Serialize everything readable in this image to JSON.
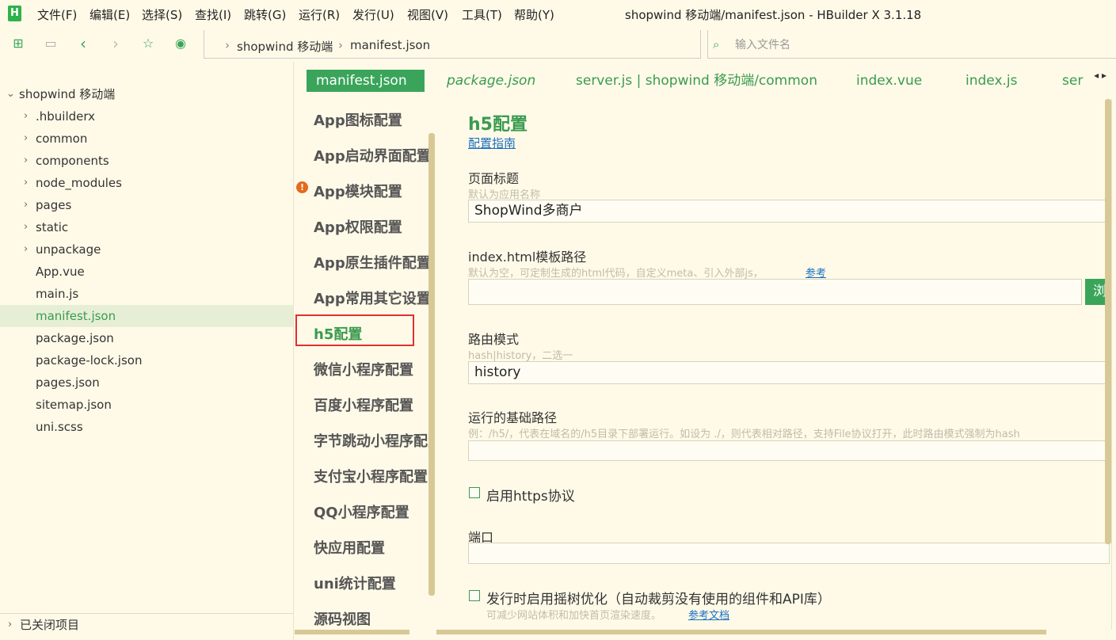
{
  "app": {
    "logo": "H",
    "window_title": "shopwind 移动端/manifest.json - HBuilder X 3.1.18"
  },
  "menu": [
    "文件(F)",
    "编辑(E)",
    "选择(S)",
    "查找(I)",
    "跳转(G)",
    "运行(R)",
    "发行(U)",
    "视图(V)",
    "工具(T)",
    "帮助(Y)"
  ],
  "toolbar": {
    "icons": [
      "new-file-icon",
      "save-icon",
      "back-icon",
      "forward-icon",
      "star-icon",
      "run-icon"
    ],
    "breadcrumb": [
      "shopwind 移动端",
      "manifest.json"
    ],
    "file_search_placeholder": "输入文件名"
  },
  "sidebar": {
    "project": "shopwind 移动端",
    "folders": [
      ".hbuilderx",
      "common",
      "components",
      "node_modules",
      "pages",
      "static",
      "unpackage"
    ],
    "files": [
      "App.vue",
      "main.js",
      "manifest.json",
      "package.json",
      "package-lock.json",
      "pages.json",
      "sitemap.json",
      "uni.scss"
    ],
    "selected_file": "manifest.json",
    "closed_projects": "已关闭项目"
  },
  "tabs": [
    {
      "label": "manifest.json",
      "active": true
    },
    {
      "label": "package.json",
      "italic": true
    },
    {
      "label": "server.js | shopwind 移动端/common"
    },
    {
      "label": "index.vue"
    },
    {
      "label": "index.js"
    },
    {
      "label": "ser"
    }
  ],
  "config_nav": {
    "items": [
      "App图标配置",
      "App启动界面配置",
      "App模块配置",
      "App权限配置",
      "App原生插件配置",
      "App常用其它设置",
      "h5配置",
      "微信小程序配置",
      "百度小程序配置",
      "字节跳动小程序配置",
      "支付宝小程序配置",
      "QQ小程序配置",
      "快应用配置",
      "uni统计配置",
      "源码视图"
    ],
    "active": "h5配置",
    "warning_item": "App模块配置"
  },
  "h5": {
    "title": "h5配置",
    "guide_link": "配置指南",
    "page_title_label": "页面标题",
    "page_title_hint": "默认为应用名称",
    "page_title_value": "ShopWind多商户",
    "template_label": "index.html模板路径",
    "template_hint": "默认为空，可定制生成的html代码，自定义meta、引入外部js，",
    "template_ref_link": "参考",
    "template_value": "",
    "browse_label": "浏",
    "router_label": "路由模式",
    "router_hint": "hash|history，二选一",
    "router_value": "history",
    "base_label": "运行的基础路径",
    "base_hint": "例：/h5/，代表在域名的/h5目录下部署运行。如设为 ./，则代表相对路径，支持File协议打开，此时路由模式强制为hash",
    "base_value": "",
    "https_label": "启用https协议",
    "https_checked": false,
    "port_label": "端口",
    "port_value": "",
    "treeshake_label": "发行时启用摇树优化（自动裁剪没有使用的组件和API库）",
    "treeshake_checked": false,
    "treeshake_hint": "可减少网站体积和加快首页渲染速度。",
    "treeshake_ref_link": "参考文档"
  }
}
